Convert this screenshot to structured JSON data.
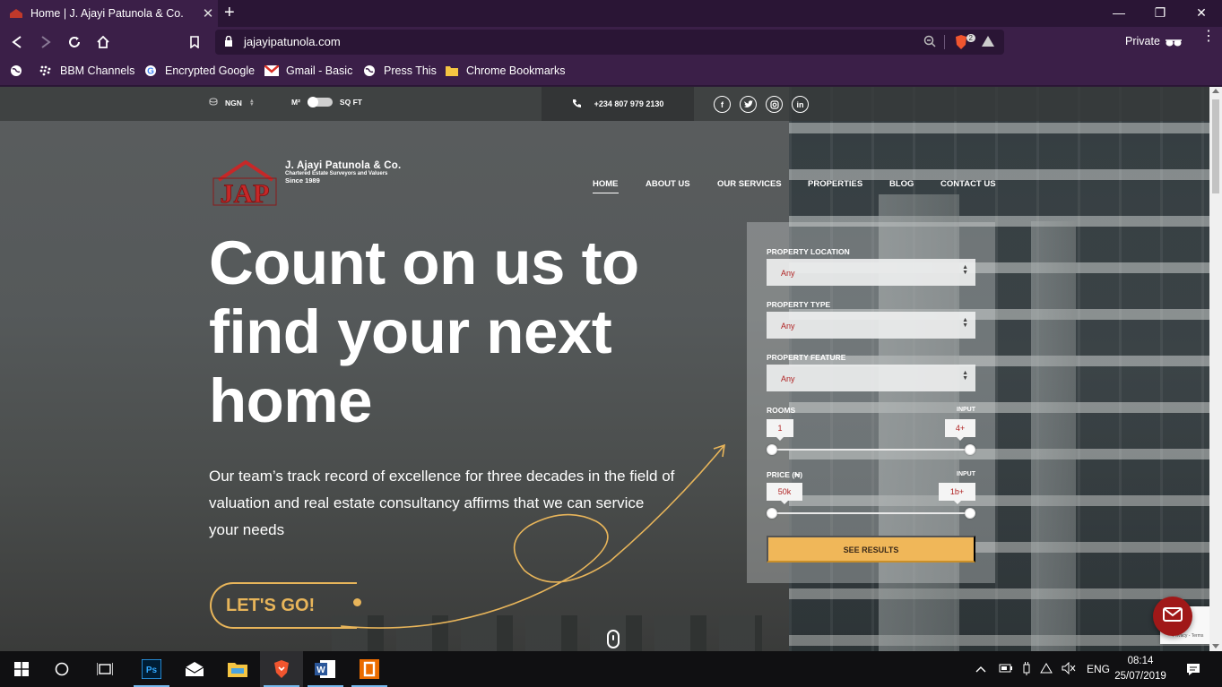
{
  "browser": {
    "tab_title": "Home | J. Ajayi Patunola & Co.",
    "url": "jajayipatunola.com",
    "brave_shield_count": "2",
    "private_label": "Private",
    "bookmarks": [
      "BBM Channels",
      "Encrypted Google",
      "Gmail - Basic",
      "Press This",
      "Chrome Bookmarks"
    ]
  },
  "topbar": {
    "currency": "NGN",
    "unit_metric": "M²",
    "unit_imperial": "SQ FT",
    "phone": "+234 807 979 2130",
    "socials": [
      "facebook-icon",
      "twitter-icon",
      "instagram-icon",
      "linkedin-icon"
    ]
  },
  "logo": {
    "name": "J. Ajayi Patunola & Co.",
    "tagline": "Chartered Estate Surveyors and Valuers",
    "since": "Since 1989"
  },
  "nav": [
    "HOME",
    "ABOUT US",
    "OUR SERVICES",
    "PROPERTIES",
    "BLOG",
    "CONTACT US"
  ],
  "hero": {
    "title_line1": "Count on us to",
    "title_line2": "find your next",
    "title_line3": "home",
    "description": "Our team’s track record of excellence for three decades in the field of valuation and real estate consultancy affirms that we can service your needs",
    "cta": "LET'S GO!"
  },
  "search": {
    "location_label": "PROPERTY LOCATION",
    "location_value": "Any",
    "type_label": "PROPERTY TYPE",
    "type_value": "Any",
    "feature_label": "PROPERTY FEATURE",
    "feature_value": "Any",
    "rooms_label": "ROOMS",
    "rooms_input_label": "INPUT",
    "rooms_min": "1",
    "rooms_max": "4+",
    "price_label": "PRICE (₦)",
    "price_input_label": "INPUT",
    "price_min": "50k",
    "price_max": "1b+",
    "submit": "SEE RESULTS"
  },
  "recaptcha_text": "Privacy - Terms",
  "taskbar": {
    "language": "ENG",
    "time": "08:14",
    "date": "25/07/2019"
  },
  "colors": {
    "accent": "#f0b759",
    "browser_purple": "#3b1f48",
    "brand_red": "#b02323"
  }
}
